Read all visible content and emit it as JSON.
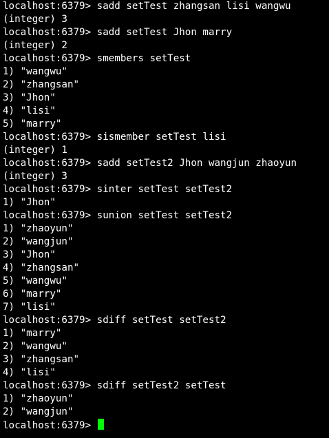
{
  "terminal": {
    "colors": {
      "background": "#000000",
      "text": "#ffffff",
      "cursor": "#00ff00"
    },
    "prompt": "localhost:6379> ",
    "lines": [
      "localhost:6379> sadd setTest zhangsan lisi wangwu",
      "(integer) 3",
      "localhost:6379> sadd setTest Jhon marry",
      "(integer) 2",
      "localhost:6379> smembers setTest",
      "1) \"wangwu\"",
      "2) \"zhangsan\"",
      "3) \"Jhon\"",
      "4) \"lisi\"",
      "5) \"marry\"",
      "localhost:6379> sismember setTest lisi",
      "(integer) 1",
      "localhost:6379> sadd setTest2 Jhon wangjun zhaoyun",
      "(integer) 3",
      "localhost:6379> sinter setTest setTest2",
      "1) \"Jhon\"",
      "localhost:6379> sunion setTest setTest2",
      "1) \"zhaoyun\"",
      "2) \"wangjun\"",
      "3) \"Jhon\"",
      "4) \"zhangsan\"",
      "5) \"wangwu\"",
      "6) \"marry\"",
      "7) \"lisi\"",
      "localhost:6379> sdiff setTest setTest2",
      "1) \"marry\"",
      "2) \"wangwu\"",
      "3) \"zhangsan\"",
      "4) \"lisi\"",
      "localhost:6379> sdiff setTest2 setTest",
      "1) \"zhaoyun\"",
      "2) \"wangjun\""
    ]
  }
}
